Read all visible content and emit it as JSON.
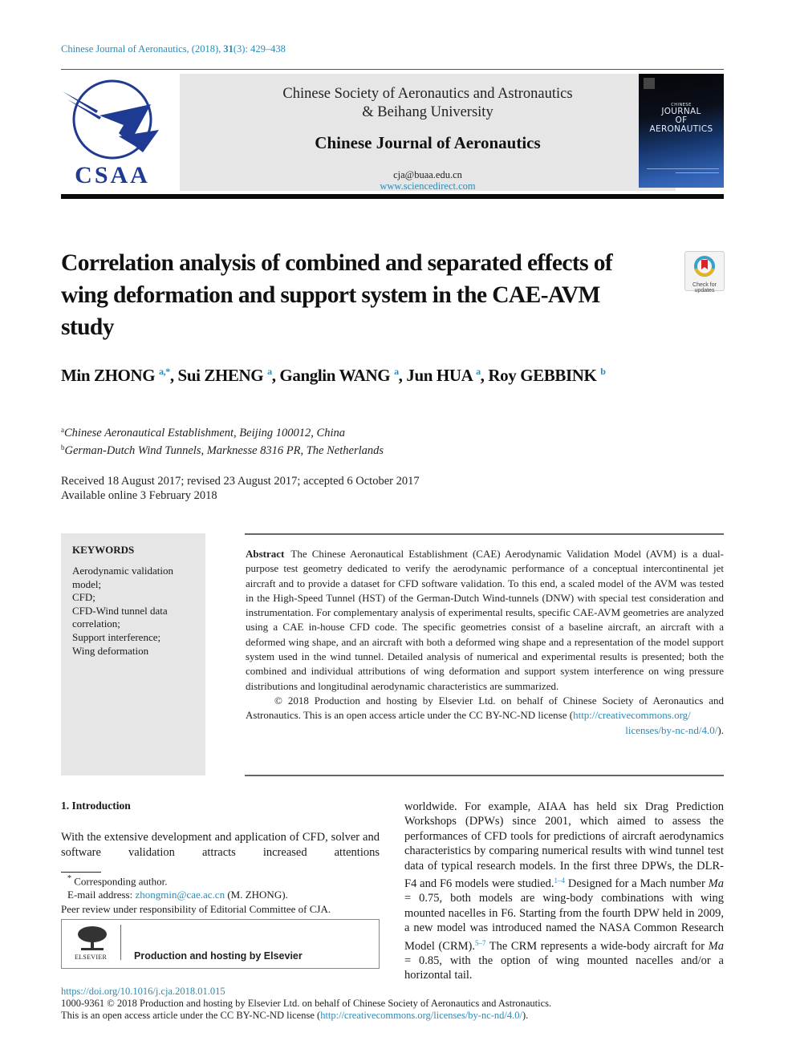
{
  "citation": {
    "journal": "Chinese Journal of Aeronautics, (2018), ",
    "volume": "31",
    "issue_pages": "(3): 429–438"
  },
  "masthead": {
    "logo_text": "CSAA",
    "society_line1": "Chinese Society of Aeronautics and Astronautics",
    "society_line2": "& Beihang University",
    "journal_name": "Chinese Journal of Aeronautics",
    "email": "cja@buaa.edu.cn",
    "website": "www.sciencedirect.com",
    "cover": {
      "small": "CHINESE",
      "title_line1": "JOURNAL",
      "title_line2": "OF",
      "title_line3": "AERONAUTICS"
    }
  },
  "article": {
    "title": "Correlation analysis of combined and separated effects of wing deformation and support system in the CAE-AVM study",
    "check_updates_line1": "Check for",
    "check_updates_line2": "updates",
    "authors": [
      {
        "name": "Min ZHONG",
        "sup": "a,*",
        "sep": ", "
      },
      {
        "name": "Sui ZHENG",
        "sup": "a",
        "sep": ", "
      },
      {
        "name": "Ganglin WANG",
        "sup": "a",
        "sep": ", "
      },
      {
        "name": "Jun HUA",
        "sup": "a",
        "sep": ", "
      },
      {
        "name": "Roy GEBBINK",
        "sup": "b",
        "sep": ""
      }
    ],
    "affiliations": [
      {
        "mark": "a",
        "text": "Chinese Aeronautical Establishment, Beijing 100012, China"
      },
      {
        "mark": "b",
        "text": "German-Dutch Wind Tunnels, Marknesse 8316 PR, The Netherlands"
      }
    ],
    "dates_line1": "Received 18 August 2017; revised 23 August 2017; accepted 6 October 2017",
    "dates_line2": "Available online 3 February 2018"
  },
  "keywords": {
    "title": "KEYWORDS",
    "items": [
      "Aerodynamic validation model;",
      "CFD;",
      "CFD-Wind tunnel data correlation;",
      "Support interference;",
      "Wing deformation"
    ]
  },
  "abstract": {
    "label": "Abstract",
    "text": "The Chinese Aeronautical Establishment (CAE) Aerodynamic Validation Model (AVM) is a dual-purpose test geometry dedicated to verify the aerodynamic performance of a conceptual intercontinental jet aircraft and to provide a dataset for CFD software validation. To this end, a scaled model of the AVM was tested in the High-Speed Tunnel (HST) of the German-Dutch Wind-tunnels (DNW) with special test consideration and instrumentation. For complementary analysis of experimental results, specific CAE-AVM geometries are analyzed using a CAE in-house CFD code. The specific geometries consist of a baseline aircraft, an aircraft with a deformed wing shape, and an aircraft with both a deformed wing shape and a representation of the model support system used in the wind tunnel. Detailed analysis of numerical and experimental results is presented; both the combined and individual attributions of wing deformation and support system interference on wing pressure distributions and longitudinal aerodynamic characteristics are summarized.",
    "copyright": "© 2018 Production and hosting by Elsevier Ltd. on behalf of Chinese Society of Aeronautics and Astronautics. This is an open access article under the CC BY-NC-ND license (",
    "license_link_part1": "http://creativecommons.org/",
    "license_link_part2": "licenses/by-nc-nd/4.0/",
    "closing": ")."
  },
  "introduction": {
    "heading": "1. Introduction",
    "left_text": "With the extensive development and application of CFD, solver and software validation attracts increased attentions",
    "right_part1": "worldwide. For example, AIAA has held six Drag Prediction Workshops (DPWs) since 2001, which aimed to assess the performances of CFD tools for predictions of aircraft aerodynamics characteristics by comparing numerical results with wind tunnel test data of typical research models. In the first three DPWs, the DLR-F4 and F6 models were studied.",
    "ref1": "1–4",
    "right_part2": " Designed for a Mach number ",
    "ma": "Ma",
    "right_part3": " = 0.75, both models are wing-body combinations with wing mounted nacelles in F6. Starting from the fourth DPW held in 2009, a new model was introduced named the NASA Common Research Model (CRM).",
    "ref2": "5–7",
    "right_part4": " The CRM represents a wide-body aircraft for ",
    "right_part5": " = 0.85, with the option of wing mounted nacelles and/or a horizontal tail."
  },
  "footnotes": {
    "corresponding": "Corresponding author.",
    "email_label": "E-mail address: ",
    "email": "zhongmin@cae.ac.cn",
    "email_suffix": " (M. ZHONG).",
    "peer_review": "Peer review under responsibility of Editorial Committee of CJA.",
    "elsevier_word": "ELSEVIER",
    "production": "Production and hosting by Elsevier"
  },
  "bottom": {
    "doi": "https://doi.org/10.1016/j.cja.2018.01.015",
    "issn_line": "1000-9361 © 2018 Production and hosting by Elsevier Ltd. on behalf of Chinese Society of Aeronautics and Astronautics.",
    "license_prefix": "This is an open access article under the CC BY-NC-ND license (",
    "license_url": "http://creativecommons.org/licenses/by-nc-nd/4.0/",
    "license_suffix": ")."
  },
  "colors": {
    "link": "#2a8bb8",
    "logo_blue": "#1f3a93",
    "masthead_gray": "#e6e6e6"
  }
}
